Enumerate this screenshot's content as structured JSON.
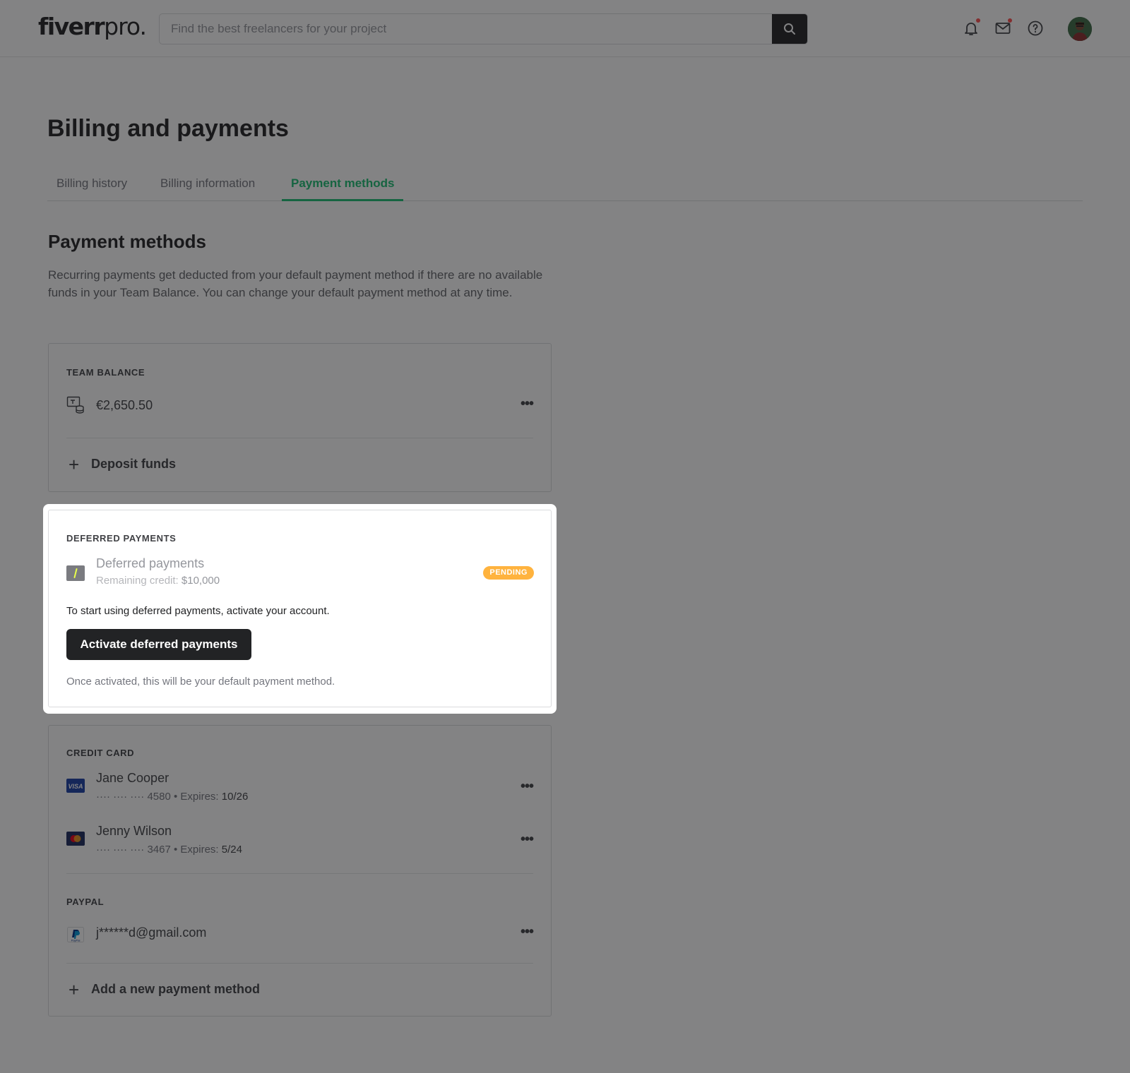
{
  "header": {
    "logo_main": "fiverr",
    "logo_suffix": "pro.",
    "search_placeholder": "Find the best freelancers for your project"
  },
  "page": {
    "title": "Billing and payments",
    "tabs": [
      {
        "label": "Billing history"
      },
      {
        "label": "Billing information"
      },
      {
        "label": "Payment methods"
      }
    ],
    "active_tab": "Payment methods"
  },
  "section": {
    "title": "Payment methods",
    "description": "Recurring payments get deducted from your default payment method if there are no available funds in your Team Balance. You can change your default payment method at any time."
  },
  "team_balance": {
    "label": "TEAM BALANCE",
    "amount": "€2,650.50",
    "deposit_label": "Deposit funds"
  },
  "deferred": {
    "label": "DEFERRED PAYMENTS",
    "name": "Deferred payments",
    "remaining_prefix": "Remaining credit:",
    "remaining_value": "$10,000",
    "badge": "PENDING",
    "notice": "To start using deferred payments, activate your account.",
    "button": "Activate deferred payments",
    "footnote": "Once activated, this will be your default payment method."
  },
  "credit_card": {
    "label": "CREDIT CARD",
    "cards": [
      {
        "name": "Jane Cooper",
        "mask": "···· ···· ···· 4580",
        "expires_label": "• Expires:",
        "expires": "10/26",
        "brand": "VISA"
      },
      {
        "name": "Jenny Wilson",
        "mask": "···· ···· ···· 3467",
        "expires_label": "• Expires:",
        "expires": "5/24",
        "brand": "mastercard"
      }
    ]
  },
  "paypal": {
    "label": "PAYPAL",
    "email": "j******d@gmail.com"
  },
  "add_method_label": "Add a new payment method",
  "more_glyph": "•••",
  "plus_glyph": "+",
  "colors": {
    "accent": "#1dbf73",
    "pending": "#ffb33e",
    "dark": "#222325"
  }
}
